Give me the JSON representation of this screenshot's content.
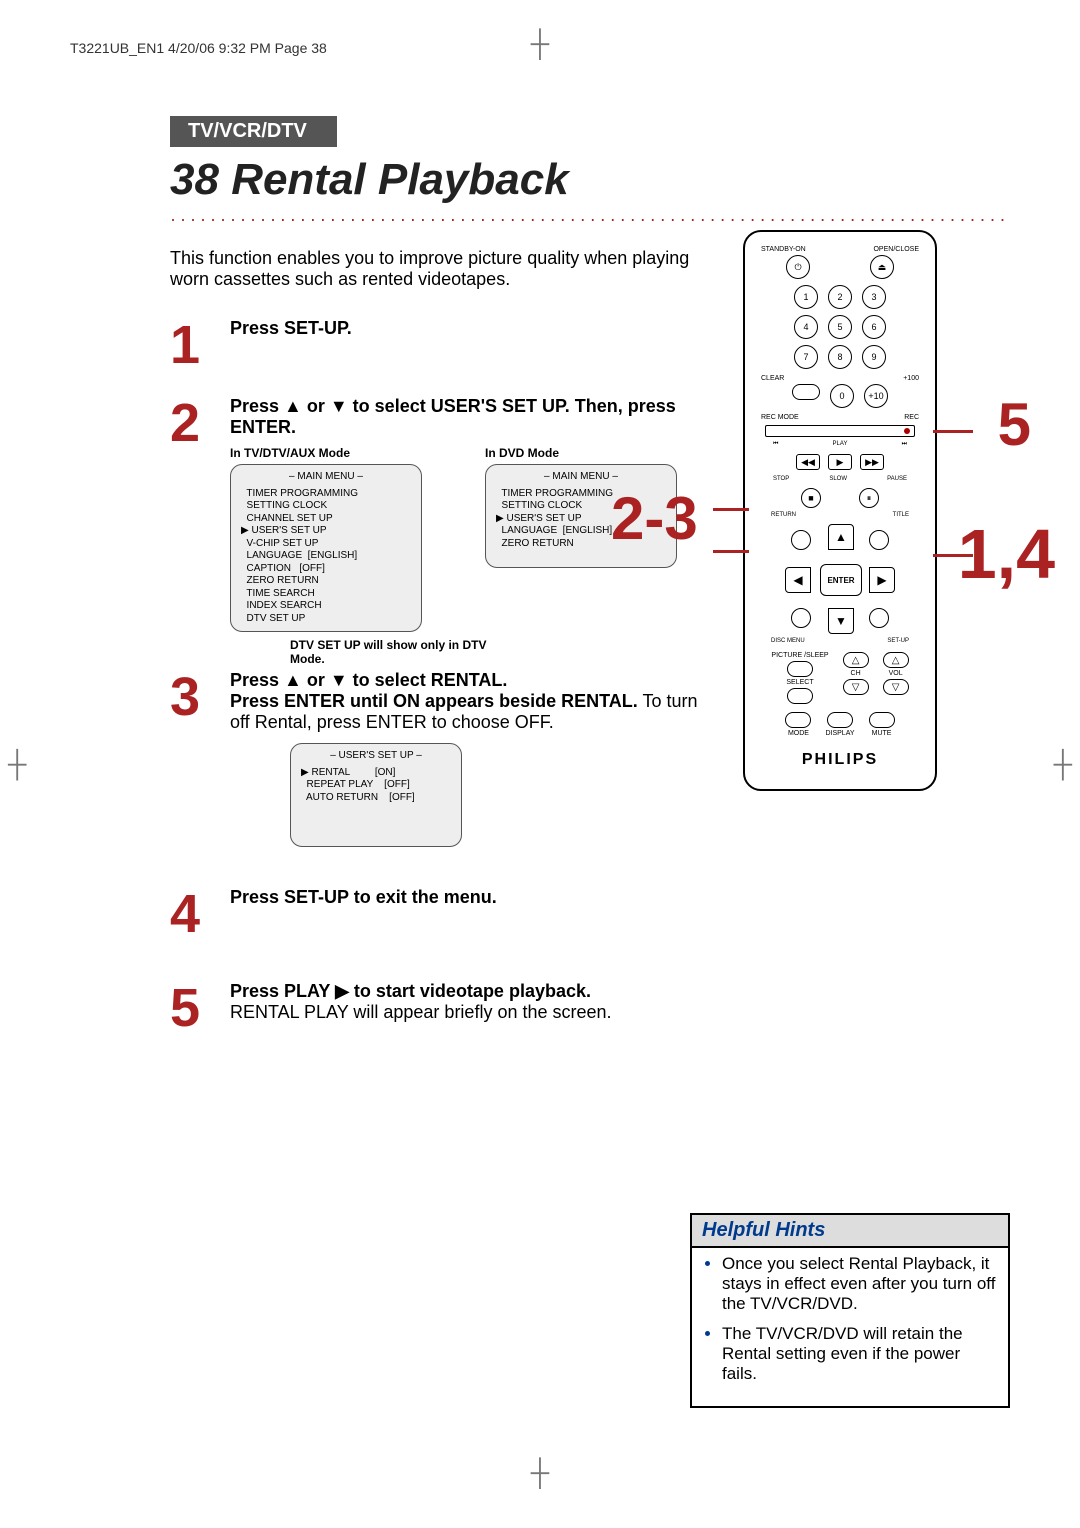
{
  "doc": {
    "running_head": "T3221UB_EN1  4/20/06  9:32 PM  Page 38",
    "section_badge": "TV/VCR/DTV",
    "page_number": "38",
    "title": "Rental Playback",
    "intro": "This function enables you to improve picture quality when playing worn cassettes such as rented videotapes."
  },
  "steps": [
    {
      "num": "1",
      "html": "Press SET-UP."
    },
    {
      "num": "2",
      "html": "Press ▲ or ▼ to select USER'S SET UP.  Then, press ENTER."
    },
    {
      "num": "3",
      "html_bold": "Press ▲ or ▼ to select RENTAL.\nPress ENTER until ON appears beside RENTAL.",
      "html_rest": " To turn off Rental, press ENTER to choose OFF."
    },
    {
      "num": "4",
      "html": "Press SET-UP to exit the menu."
    },
    {
      "num": "5",
      "html_bold": "Press PLAY ▶ to start videotape playback.",
      "html_rest": " RENTAL PLAY will appear briefly on the screen."
    }
  ],
  "menus": {
    "tv_mode_label": "In TV/DTV/AUX Mode",
    "dvd_mode_label": "In DVD Mode",
    "main_menu_title": "– MAIN MENU –",
    "tv_lines": [
      "  TIMER PROGRAMMING",
      "  SETTING CLOCK",
      "  CHANNEL SET UP",
      "▶ USER'S SET UP",
      "  V-CHIP SET UP",
      "  LANGUAGE  [ENGLISH]",
      "  CAPTION   [OFF]",
      "  ZERO RETURN",
      "  TIME SEARCH",
      "  INDEX SEARCH",
      "  DTV SET UP"
    ],
    "dvd_lines": [
      "  TIMER PROGRAMMING",
      "  SETTING CLOCK",
      "▶ USER'S SET UP",
      "  LANGUAGE  [ENGLISH]",
      "  ZERO RETURN"
    ],
    "dtv_note": "DTV SET UP will show only in DTV Mode.",
    "user_setup_title": "– USER'S SET UP –",
    "user_setup_lines": [
      "▶ RENTAL         [ON]",
      "  REPEAT PLAY    [OFF]",
      "  AUTO RETURN    [OFF]"
    ]
  },
  "remote": {
    "top_left_label": "STANDBY-ON",
    "top_right_label": "OPEN/CLOSE",
    "power_icon": "⏻",
    "eject_icon": "⏏",
    "num_1": "1",
    "num_2": "2",
    "num_3": "3",
    "num_4": "4",
    "num_5": "5",
    "num_6": "6",
    "num_7": "7",
    "num_8": "8",
    "num_9": "9",
    "clear_label": "CLEAR",
    "num_0": "0",
    "plus100_label": "+100",
    "plus100_sub": "+10",
    "recmode_label": "REC MODE",
    "rec_label": "REC",
    "prev_label": "⏮",
    "play_text": "PLAY",
    "next_label": "⏭",
    "play_icon": "▶",
    "rw_icon": "◀◀",
    "ff_icon": "▶▶",
    "stop_label": "STOP",
    "slow_label": "SLOW",
    "pause_label": "PAUSE",
    "stop_icon": "■",
    "pause_icon": "⏸",
    "return_label": "RETURN",
    "title_label": "TITLE",
    "up": "▲",
    "down": "▼",
    "left": "◀",
    "right": "▶",
    "enter": "ENTER",
    "disc_label": "DISC MENU",
    "setup_label": "SET-UP",
    "picture_label": "PICTURE /SLEEP",
    "ch_label": "CH",
    "vol_label": "VOL",
    "up_tri": "△",
    "down_tri": "▽",
    "select_label": "SELECT",
    "mode_label": "MODE",
    "display_label": "DISPLAY",
    "mute_label": "MUTE",
    "brand": "PHILIPS"
  },
  "callouts": {
    "c5": "5",
    "c23": "2-3",
    "c14": "1,4"
  },
  "hints": {
    "title": "Helpful Hints",
    "items": [
      "Once you select Rental Playback, it stays in effect even after you turn off the TV/VCR/DVD.",
      "The TV/VCR/DVD will retain the Rental setting even if the power fails."
    ]
  }
}
